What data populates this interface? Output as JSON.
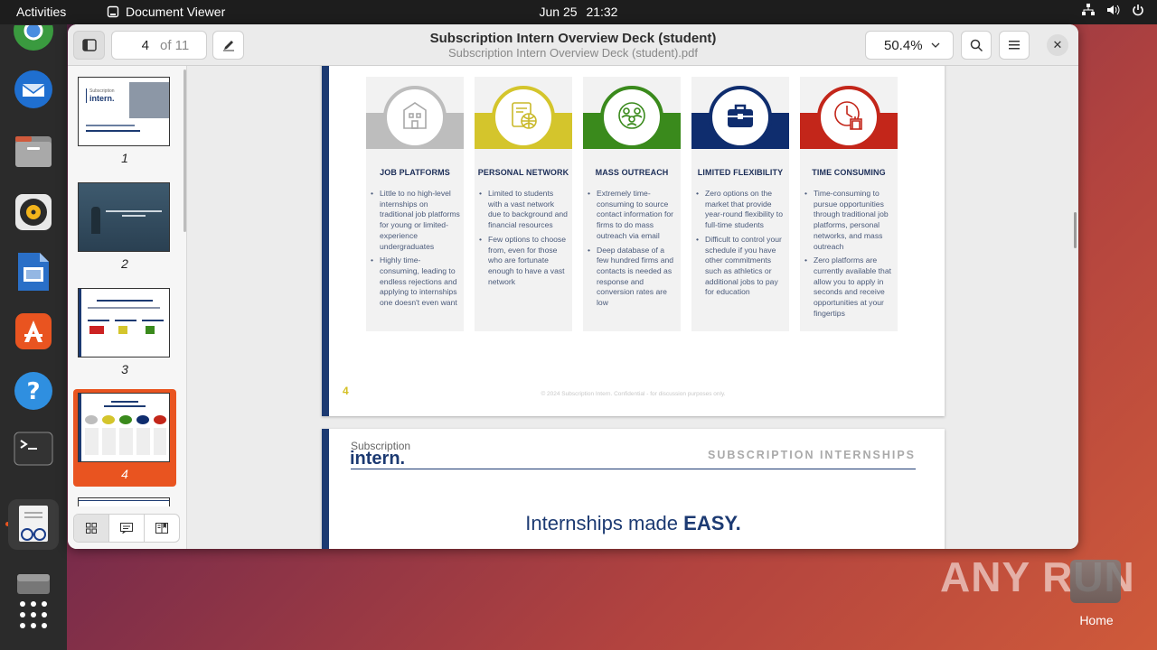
{
  "topbar": {
    "activities": "Activities",
    "app_name": "Document Viewer",
    "date": "Jun 25",
    "time": "21:32"
  },
  "window": {
    "page_current": "4",
    "page_total": "of 11",
    "title": "Subscription Intern Overview Deck (student)",
    "subtitle": "Subscription Intern Overview Deck (student).pdf",
    "zoom": "50.4%"
  },
  "thumbnails": [
    {
      "label": "1"
    },
    {
      "label": "2",
      "text": "We started Subscription Internships as a..."
    },
    {
      "label": "3"
    },
    {
      "label": "4",
      "selected": true
    }
  ],
  "page4": {
    "cards": [
      {
        "title": "JOB PLATFORMS",
        "color": "#bdbdbd",
        "icon": "building-icon",
        "bullets": [
          "Little to no high-level internships on traditional job platforms for young or limited-experience undergraduates",
          "Highly time-consuming, leading to endless rejections and applying to internships one doesn't even want"
        ]
      },
      {
        "title": "PERSONAL NETWORK",
        "color": "#d4c52c",
        "icon": "globe-document-icon",
        "bullets": [
          "Limited to students with a vast network due to background and financial resources",
          "Few options to choose from, even for those who are fortunate enough to have a vast network"
        ]
      },
      {
        "title": "MASS OUTREACH",
        "color": "#3a8a1c",
        "icon": "people-network-icon",
        "bullets": [
          "Extremely time-consuming to source contact information for firms to do mass outreach via email",
          "Deep database of a few hundred firms and contacts is needed as response and conversion rates are low"
        ]
      },
      {
        "title": "LIMITED FLEXIBILITY",
        "color": "#0f2d6e",
        "icon": "briefcase-icon",
        "bullets": [
          "Zero options on the market that provide year-round flexibility to full-time students",
          "Difficult to control your schedule if you have other commitments such as athletics or additional jobs to pay for education"
        ]
      },
      {
        "title": "TIME CONSUMING",
        "color": "#c3261a",
        "icon": "clock-icon",
        "bullets": [
          "Time-consuming to pursue opportunities through traditional job platforms, personal networks, and mass outreach",
          "Zero platforms are currently available that allow you to apply in seconds and receive opportunities at your fingertips"
        ]
      }
    ],
    "page_number": "4",
    "footer": "© 2024 Subscription Intern. Confidential - for discussion purposes only."
  },
  "page5": {
    "logo_small": "Subscription",
    "logo_big": "intern.",
    "brand_caps": "SUBSCRIPTION INTERNSHIPS",
    "tagline_prefix": "Internships made ",
    "tagline_bold": "EASY."
  },
  "desktop": {
    "home_label": "Home",
    "watermark": "ANY RUN"
  },
  "colors": {
    "accent": "#e95420",
    "navy": "#1c3a72"
  }
}
